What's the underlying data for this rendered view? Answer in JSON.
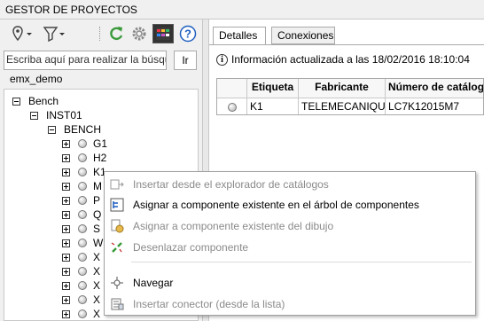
{
  "window": {
    "title": "GESTOR DE PROYECTOS"
  },
  "toolbar": {
    "icons": [
      "map-pin-icon",
      "filter-icon",
      "refresh-icon",
      "settings-icon",
      "catalog-icon",
      "help-icon"
    ]
  },
  "search": {
    "placeholder": "Escriba aquí para realizar la búsqueda",
    "button_label": "Ir"
  },
  "project": {
    "name": "emx_demo"
  },
  "tree": {
    "root": "Bench",
    "inst": "INST01",
    "group": "BENCH",
    "items": [
      "G1",
      "H2",
      "K1",
      "M",
      "P",
      "Q",
      "S",
      "W",
      "X",
      "X",
      "X",
      "X",
      "X"
    ]
  },
  "tabs": [
    "Detalles",
    "Conexiones"
  ],
  "info": {
    "text": "Información actualizada a las",
    "timestamp": "18/02/2016 18:10:04"
  },
  "grid": {
    "columns": [
      "",
      "Etiqueta",
      "Fabricante",
      "Número de catálogo"
    ],
    "rows": [
      {
        "etiqueta": "K1",
        "fabricante": "TELEMECANIQUE",
        "catalogo": "LC7K12015M7"
      }
    ]
  },
  "context_menu": {
    "items": [
      {
        "label": "Insertar desde el explorador de catálogos",
        "icon": "insert-catalog-icon",
        "enabled": false
      },
      {
        "label": "Asignar a componente existente en el árbol de componentes",
        "icon": "assign-tree-icon",
        "enabled": true
      },
      {
        "label": "Asignar a componente existente del dibujo",
        "icon": "assign-drawing-icon",
        "enabled": false
      },
      {
        "label": "Desenlazar componente",
        "icon": "unlink-icon",
        "enabled": false
      },
      {
        "label": "Navegar",
        "icon": "navigate-icon",
        "enabled": true
      },
      {
        "label": "Insertar conector (desde la lista)",
        "icon": "insert-connector-icon",
        "enabled": false
      }
    ]
  },
  "colors": {
    "refresh_green": "#3a9a3a",
    "help_blue": "#1f5fbf",
    "disabled_text": "#8a8a8a"
  }
}
